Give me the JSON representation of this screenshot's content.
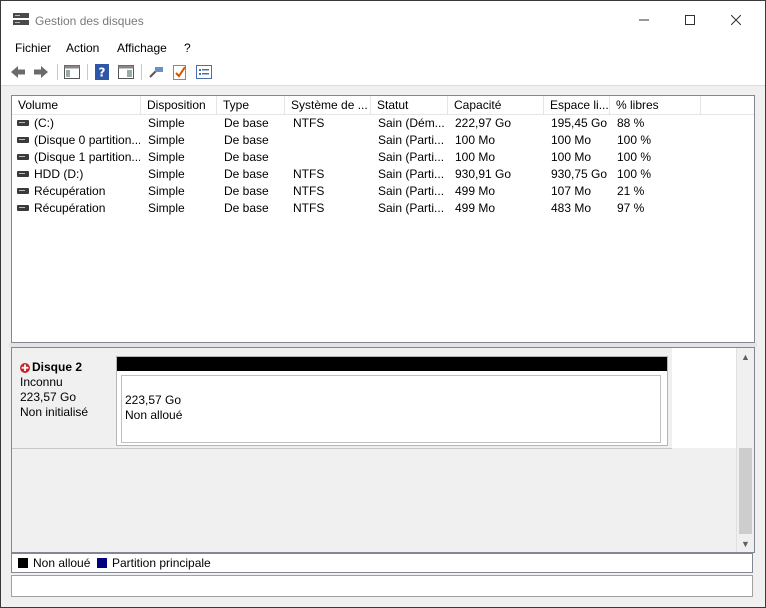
{
  "window": {
    "title": "Gestion des disques"
  },
  "menu": [
    "Fichier",
    "Action",
    "Affichage",
    "?"
  ],
  "columns": [
    "Volume",
    "Disposition",
    "Type",
    "Système de ...",
    "Statut",
    "Capacité",
    "Espace li...",
    "% libres"
  ],
  "rows": [
    [
      "(C:)",
      "Simple",
      "De base",
      "NTFS",
      "Sain (Dém...",
      "222,97 Go",
      "195,45 Go",
      "88 %"
    ],
    [
      "(Disque 0 partition...",
      "Simple",
      "De base",
      "",
      "Sain (Parti...",
      "100 Mo",
      "100 Mo",
      "100 %"
    ],
    [
      "(Disque 1 partition...",
      "Simple",
      "De base",
      "",
      "Sain (Parti...",
      "100 Mo",
      "100 Mo",
      "100 %"
    ],
    [
      "HDD (D:)",
      "Simple",
      "De base",
      "NTFS",
      "Sain (Parti...",
      "930,91 Go",
      "930,75 Go",
      "100 %"
    ],
    [
      "Récupération",
      "Simple",
      "De base",
      "NTFS",
      "Sain (Parti...",
      "499 Mo",
      "107 Mo",
      "21 %"
    ],
    [
      "Récupération",
      "Simple",
      "De base",
      "NTFS",
      "Sain (Parti...",
      "499 Mo",
      "483 Mo",
      "97 %"
    ]
  ],
  "disk": {
    "name": "Disque 2",
    "type": "Inconnu",
    "size": "223,57 Go",
    "status": "Non initialisé",
    "partition_size": "223,57 Go",
    "partition_status": "Non alloué"
  },
  "legend": [
    {
      "label": "Non alloué",
      "color": "#000000"
    },
    {
      "label": "Partition principale",
      "color": "#000080"
    }
  ],
  "colors": {
    "unallocated": "#000000",
    "primary_partition": "#000080",
    "disk_error": "#c62828"
  },
  "icons": {
    "toolbar": [
      "back-arrow-icon",
      "forward-arrow-icon",
      "console-tree-icon",
      "help-icon",
      "properties-icon",
      "connect-icon",
      "checklist-icon",
      "view-list-icon"
    ],
    "window": [
      "minimize-icon",
      "maximize-icon",
      "close-icon"
    ]
  }
}
